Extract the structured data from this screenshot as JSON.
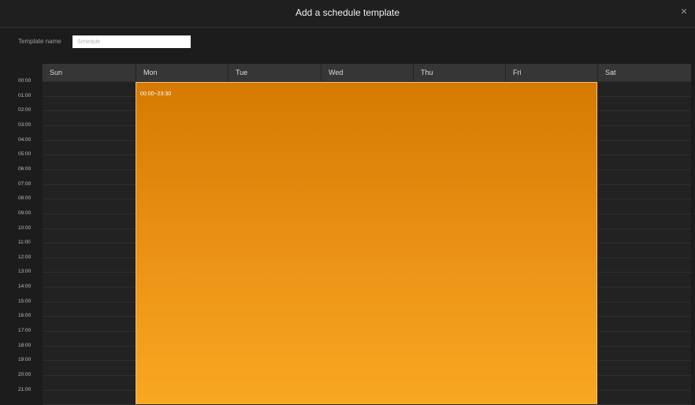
{
  "dialog": {
    "title": "Add a schedule template",
    "close_glyph": "×"
  },
  "template": {
    "label": "Template name",
    "placeholder": "Schedule",
    "value": ""
  },
  "days": [
    "Sun",
    "Mon",
    "Tue",
    "Wed",
    "Thu",
    "Fri",
    "Sat"
  ],
  "times": [
    "00:00",
    "01:00",
    "02:00",
    "03:00",
    "04:00",
    "05:00",
    "06:00",
    "07:00",
    "08:00",
    "09:00",
    "10:00",
    "11:00",
    "12:00",
    "13:00",
    "14:00",
    "15:00",
    "16:00",
    "17:00",
    "18:00",
    "19:00",
    "20:00",
    "21:00"
  ],
  "schedule": {
    "label": "00:00~23:30",
    "days": [
      "Mon",
      "Tue",
      "Wed",
      "Thu",
      "Fri"
    ],
    "start": "00:00",
    "end": "23:30"
  },
  "colors": {
    "block_top": "#d57a02",
    "block_bottom": "#f9a823",
    "header_bg": "#363636",
    "background": "#1c1c1c"
  }
}
